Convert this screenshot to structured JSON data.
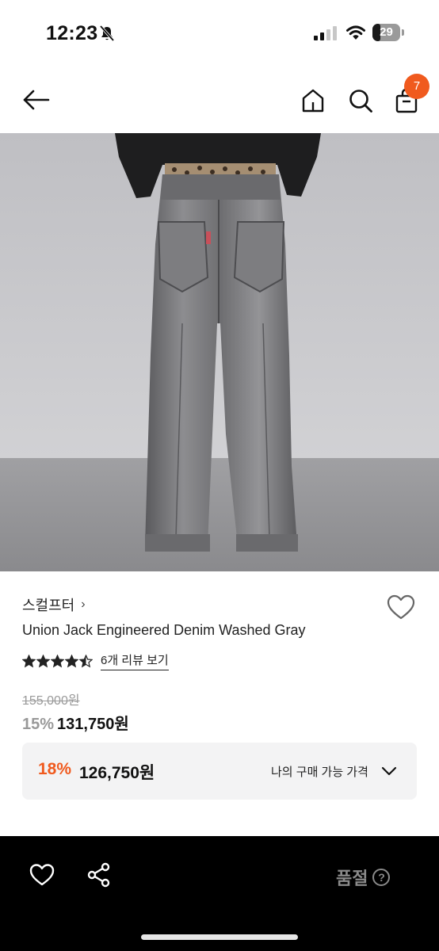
{
  "status_bar": {
    "time": "12:23",
    "battery_level": "29",
    "battery_fraction": 0.29
  },
  "header": {
    "cart_count": "7",
    "icons": [
      "back-arrow-icon",
      "home-icon",
      "search-icon",
      "shopping-bag-icon"
    ]
  },
  "product": {
    "brand": "스컬프터",
    "brand_chevron": "›",
    "name": "Union Jack Engineered Denim Washed Gray",
    "rating_stars": 4.5,
    "review_link": "6개 리뷰 보기",
    "original_price": "155,000원",
    "discount_rate": "15%",
    "sale_price": "131,750원"
  },
  "my_price": {
    "discount_rate": "18%",
    "price": "126,750원",
    "label": "나의 구매 가능 가격"
  },
  "bottom_bar": {
    "status_label": "품절",
    "help_glyph": "?"
  },
  "colors": {
    "accent": "#f05a1e",
    "bottom_bar": "#000000",
    "muted": "#999999"
  }
}
